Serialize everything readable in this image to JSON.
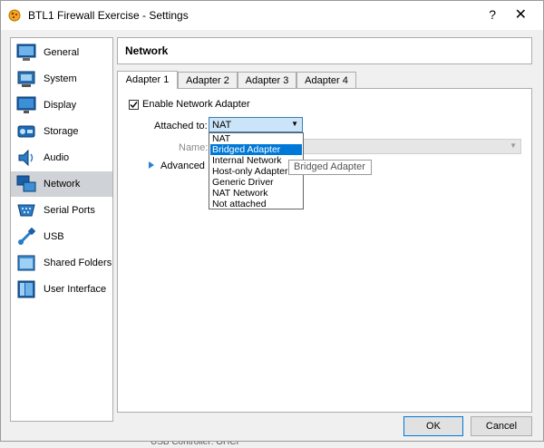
{
  "window": {
    "title": "BTL1 Firewall Exercise - Settings",
    "help": "?",
    "close": "✕"
  },
  "sidebar": {
    "items": [
      {
        "label": "General",
        "icon": "general-icon"
      },
      {
        "label": "System",
        "icon": "system-icon"
      },
      {
        "label": "Display",
        "icon": "display-icon"
      },
      {
        "label": "Storage",
        "icon": "storage-icon"
      },
      {
        "label": "Audio",
        "icon": "audio-icon"
      },
      {
        "label": "Network",
        "icon": "network-icon",
        "selected": true
      },
      {
        "label": "Serial Ports",
        "icon": "serial-ports-icon"
      },
      {
        "label": "USB",
        "icon": "usb-icon"
      },
      {
        "label": "Shared Folders",
        "icon": "shared-folders-icon"
      },
      {
        "label": "User Interface",
        "icon": "user-interface-icon"
      }
    ]
  },
  "main": {
    "title": "Network",
    "tabs": [
      {
        "label": "Adapter 1",
        "active": true
      },
      {
        "label": "Adapter 2"
      },
      {
        "label": "Adapter 3"
      },
      {
        "label": "Adapter 4"
      }
    ],
    "enable_label": "Enable Network Adapter",
    "enable_checked": true,
    "attached_label": "Attached to:",
    "attached_value": "NAT",
    "name_label": "Name:",
    "advanced_label": "Advanced",
    "dropdown_options": [
      "NAT",
      "Bridged Adapter",
      "Internal Network",
      "Host-only Adapter",
      "Generic Driver",
      "NAT Network",
      "Not attached"
    ],
    "highlighted_option": "Bridged Adapter",
    "tooltip": "Bridged Adapter"
  },
  "buttons": {
    "ok": "OK",
    "cancel": "Cancel"
  },
  "background": {
    "bottom_text": "USB Controller:   OHCI"
  },
  "colors": {
    "accent": "#0078d7",
    "selected_bg": "#cfd2d6"
  }
}
